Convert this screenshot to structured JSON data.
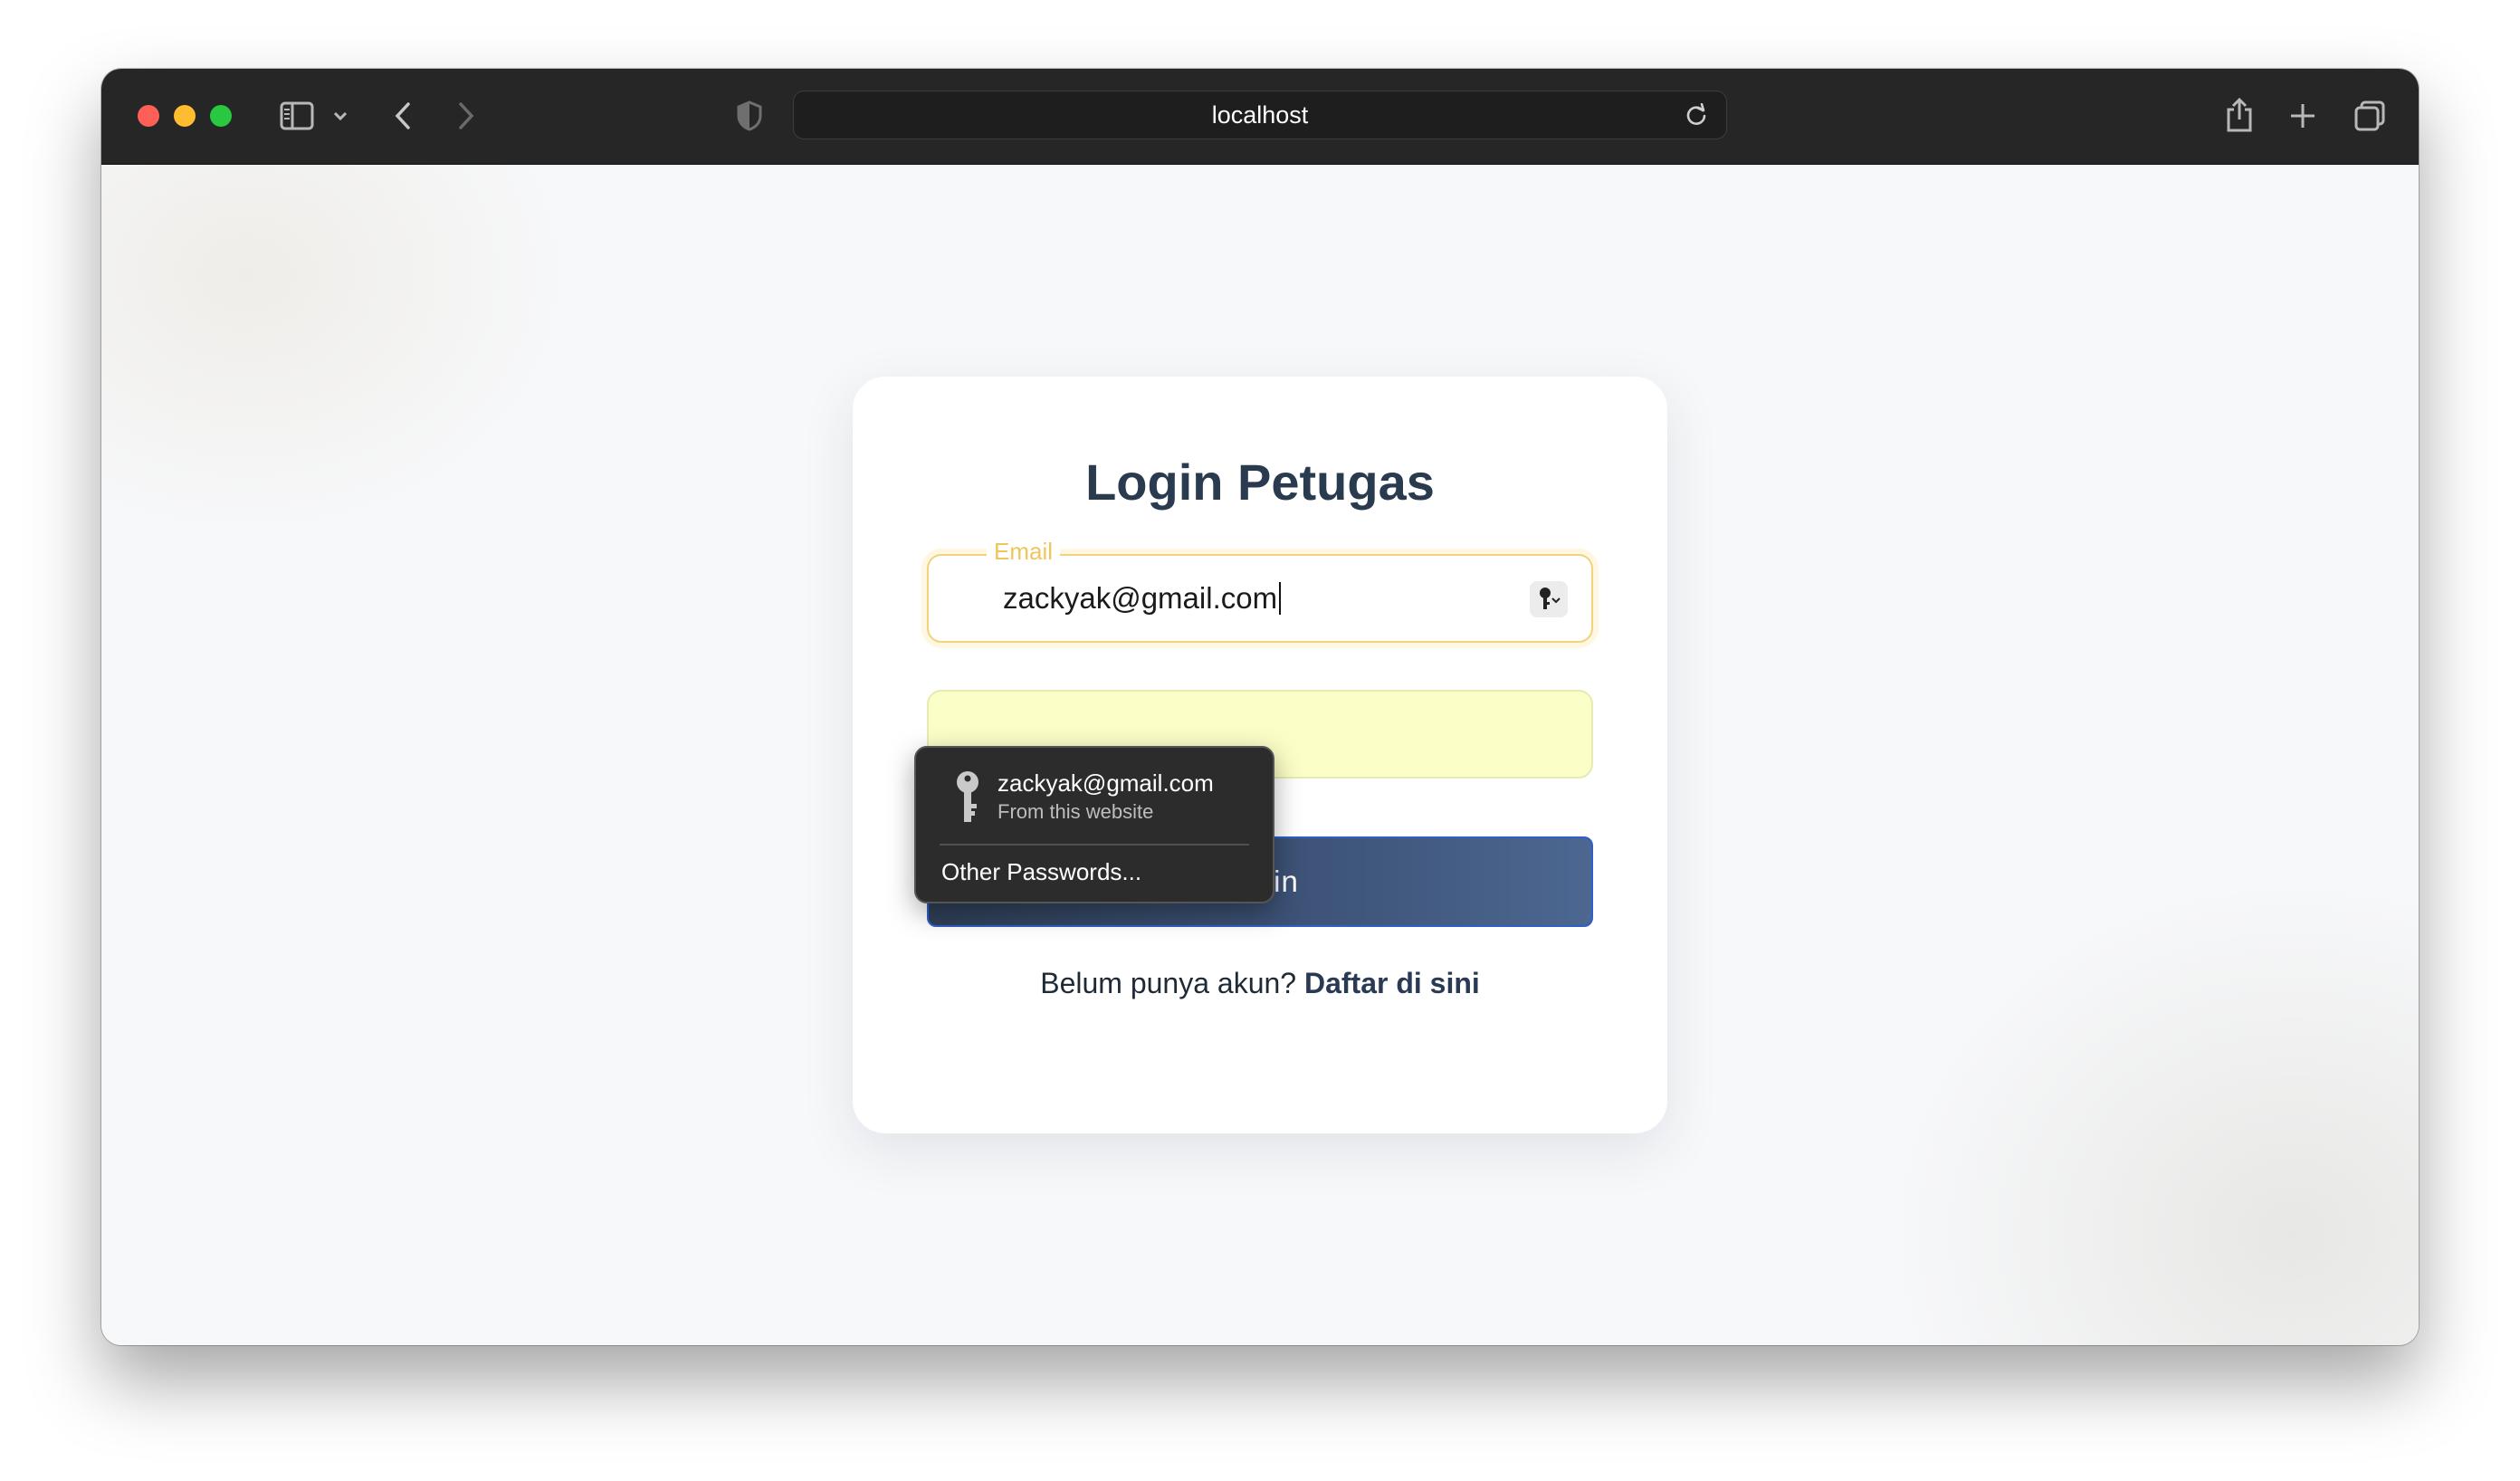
{
  "browser": {
    "url": "localhost"
  },
  "login": {
    "title": "Login Petugas",
    "email_label": "Email",
    "email_value": "zackyak@gmail.com",
    "password_value": "",
    "submit_label": "Login",
    "register_prompt": "Belum punya akun?",
    "register_link": "Daftar di sini"
  },
  "autofill": {
    "username": "zackyak@gmail.com",
    "source": "From this website",
    "other": "Other Passwords..."
  },
  "colors": {
    "accent_gold": "#f3d27a",
    "button_start": "#2f3f58",
    "button_end": "#4c6791",
    "title": "#2a3a4f"
  }
}
